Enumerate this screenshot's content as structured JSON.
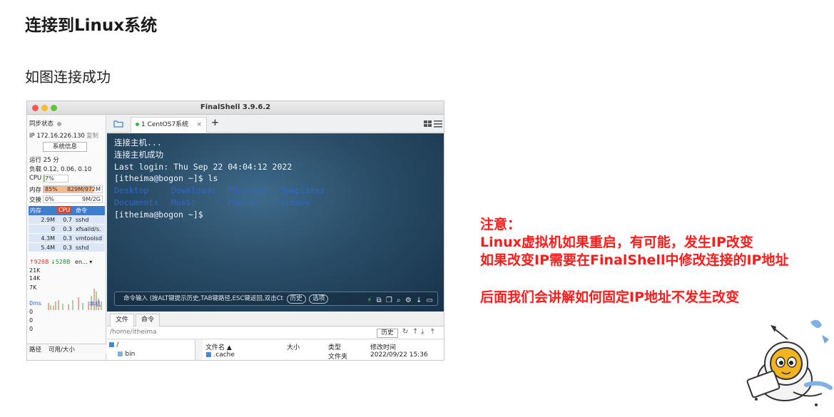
{
  "slide": {
    "title": "连接到Linux系统",
    "subtitle": "如图连接成功"
  },
  "window": {
    "title": "FinalShell 3.9.6.2"
  },
  "sidebar": {
    "sync_label": "同步状态",
    "ip_label": "IP 172.16.226.130",
    "copy_label": "复制",
    "sysinfo_button": "系统信息",
    "uptime": "运行 25 分",
    "load": "负载 0.12, 0.06, 0.10",
    "cpu_label": "CPU",
    "cpu_value": "7%",
    "cpu_fraction": 0.07,
    "mem_label": "内存",
    "mem_percent": "85%",
    "mem_value": "829M/972M",
    "mem_fraction": 0.85,
    "swap_label": "交换",
    "swap_percent": "0%",
    "swap_value": "9M/2G",
    "proc_headers": [
      "内存",
      "CPU",
      "命令"
    ],
    "processes": [
      {
        "mem": "2.9M",
        "cpu": "0.7",
        "cmd": "sshd"
      },
      {
        "mem": "0",
        "cpu": "0.3",
        "cmd": "xfsaild/s."
      },
      {
        "mem": "4.3M",
        "cpu": "0.3",
        "cmd": "vmtoolsd"
      },
      {
        "mem": "5.4M",
        "cpu": "0.3",
        "cmd": "sshd"
      }
    ],
    "net_up": "928B",
    "net_down": "528B",
    "net_iface": "en...",
    "net_scale": [
      "21K",
      "14K",
      "7K"
    ],
    "latency_label": "0ms",
    "latency_host": "本机",
    "latency_values": [
      "0",
      "0",
      "0"
    ],
    "path_header": "路径",
    "size_header": "可用/大小"
  },
  "tabs": {
    "active_tab": "1 CentOS7系统",
    "close_symbol": "×",
    "add_symbol": "+"
  },
  "terminal": {
    "lines": [
      "连接主机...",
      "连接主机成功",
      "Last login: Thu Sep 22 04:04:12 2022",
      "[itheima@bogon ~]$ ls"
    ],
    "dirs_row1": [
      "Desktop",
      "Downloads",
      "Pictures",
      "Templates"
    ],
    "dirs_row2": [
      "Documents",
      "Music",
      "Public",
      "Videos"
    ],
    "prompt": "[itheima@bogon ~]$",
    "dir_color": "#2f66c9"
  },
  "command_bar": {
    "text": "命令输入 (按ALT键提示历史,TAB键路径,ESC键返回,双击Ct",
    "history_button": "历史",
    "options_button": "选项"
  },
  "file_panel": {
    "tab_files": "文件",
    "tab_commands": "命令",
    "path": "/home/itheima",
    "history_button": "历史",
    "tree_root": "/",
    "tree_child": "bin",
    "columns": [
      "文件名 ▲",
      "大小",
      "类型",
      "修改时间"
    ],
    "rows": [
      {
        "name": ".cache",
        "size": "",
        "type": "文件夹",
        "modified": "2022/09/22 15:36"
      }
    ]
  },
  "note": {
    "heading": "注意：",
    "line1": "Linux虚拟机如果重启，有可能，发生IP改变",
    "line2": "如果改变IP需要在FinalShell中修改连接的IP地址",
    "line3": "后面我们会讲解如何固定IP地址不发生改变",
    "color": "#ff1a1a"
  }
}
